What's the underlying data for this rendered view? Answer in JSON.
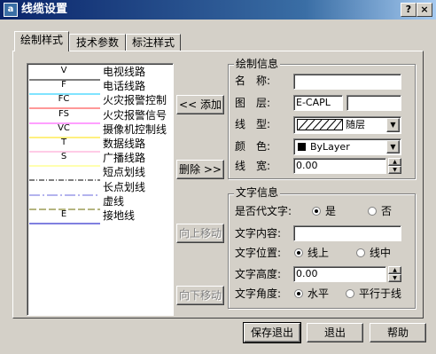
{
  "window": {
    "title": "线缆设置",
    "help_glyph": "?",
    "close_glyph": "×"
  },
  "tabs": [
    {
      "label": "绘制样式"
    },
    {
      "label": "技术参数"
    },
    {
      "label": "标注样式"
    }
  ],
  "cable_list": [
    {
      "code": "V",
      "name": "电视线路",
      "line_color": "#000000",
      "line_style": "solid"
    },
    {
      "code": "F",
      "name": "电话线路",
      "line_color": "#00c8ff",
      "line_style": "solid"
    },
    {
      "code": "FC",
      "name": "火灾报警控制",
      "line_color": "#ff3030",
      "line_style": "solid"
    },
    {
      "code": "FS",
      "name": "火灾报警信号",
      "line_color": "#ff40ff",
      "line_style": "solid"
    },
    {
      "code": "VC",
      "name": "摄像机控制线",
      "line_color": "#ffe000",
      "line_style": "solid"
    },
    {
      "code": "T",
      "name": "数据线路",
      "line_color": "#ff9acd",
      "line_style": "solid"
    },
    {
      "code": "S",
      "name": "广播线路",
      "line_color": "#ffff60",
      "line_style": "solid"
    },
    {
      "code": "",
      "name": "短点划线",
      "line_color": "#000000",
      "line_style": "dashdot-short"
    },
    {
      "code": "",
      "name": "长点划线",
      "line_color": "#6a6adc",
      "line_style": "dashdot-long"
    },
    {
      "code": "",
      "name": "虚线",
      "line_color": "#6b6b00",
      "line_style": "dashed"
    },
    {
      "code": "E",
      "name": "接地线",
      "line_color": "#0000c0",
      "line_style": "solid"
    }
  ],
  "buttons": {
    "add": "<< 添加",
    "delete": "删除 >>",
    "move_up": "向上移动",
    "move_down": "向下移动",
    "save_exit": "保存退出",
    "exit": "退出",
    "help": "帮助"
  },
  "draw_info": {
    "group_title": "绘制信息",
    "name_label": "名　称:",
    "name_value": "",
    "layer_label": "图　层:",
    "layer_value": "E-CAPL",
    "layer_extra": "",
    "linetype_label": "线　型:",
    "linetype_value": "随层",
    "color_label": "颜　色:",
    "color_value": "ByLayer",
    "color_swatch": "#000000",
    "width_label": "线　宽:",
    "width_value": "0.00"
  },
  "text_info": {
    "group_title": "文字信息",
    "replace_label": "是否代文字:",
    "replace_yes": "是",
    "replace_no": "否",
    "replace_selected": "是",
    "content_label": "文字内容:",
    "content_value": "",
    "position_label": "文字位置:",
    "position_above": "线上",
    "position_middle": "线中",
    "position_selected": "线上",
    "height_label": "文字高度:",
    "height_value": "0.00",
    "angle_label": "文字角度:",
    "angle_horizontal": "水平",
    "angle_parallel": "平行于线",
    "angle_selected": "水平"
  }
}
